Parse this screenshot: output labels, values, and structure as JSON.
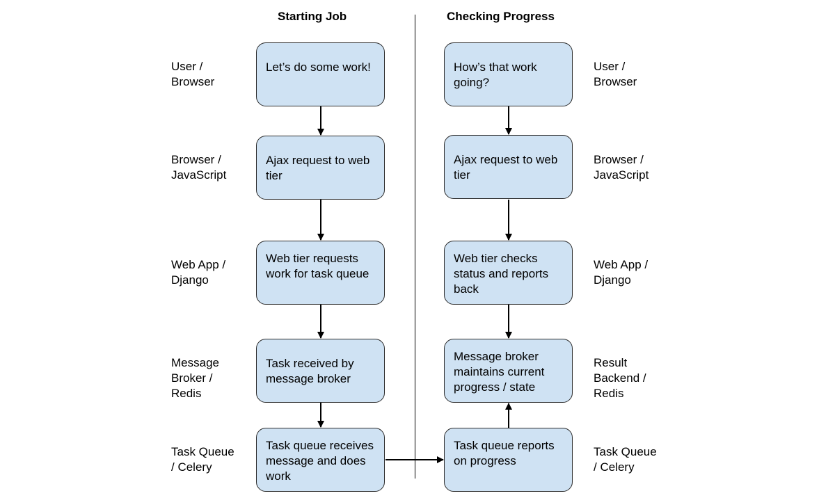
{
  "headings": {
    "left": "Starting Job",
    "right": "Checking Progress"
  },
  "left_layers": [
    "User /\nBrowser",
    "Browser /\nJavaScript",
    "Web App /\nDjango",
    "Message\nBroker /\nRedis",
    "Task Queue\n/ Celery"
  ],
  "right_layers": [
    "User /\nBrowser",
    "Browser /\nJavaScript",
    "Web App /\nDjango",
    "Result\nBackend /\nRedis",
    "Task Queue\n/ Celery"
  ],
  "starting_job": [
    "Let’s do some work!",
    "Ajax request to web tier",
    "Web tier requests work for task queue",
    "Task received by message broker",
    "Task queue receives message and does work"
  ],
  "checking_progress": [
    "How’s that work going?",
    "Ajax request to web tier",
    "Web tier checks status and reports back",
    "Message broker maintains current progress / state",
    "Task queue reports on progress"
  ],
  "colors": {
    "node_fill": "#cfe2f3",
    "node_border": "#2b2b2b",
    "line": "#000000"
  }
}
